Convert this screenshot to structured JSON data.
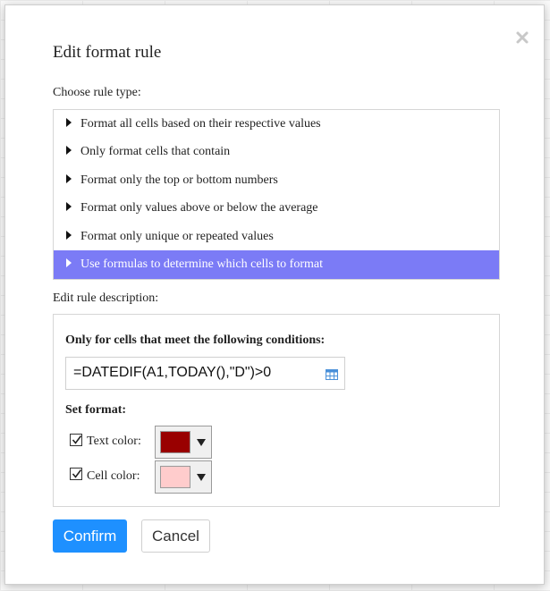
{
  "dialog": {
    "title": "Edit format rule",
    "close_icon": "close-icon"
  },
  "rule_type": {
    "label": "Choose rule type:",
    "items": [
      {
        "label": "Format all cells based on their respective values",
        "selected": false
      },
      {
        "label": "Only format cells that contain",
        "selected": false
      },
      {
        "label": "Format only the top or bottom numbers",
        "selected": false
      },
      {
        "label": "Format only values above or below the average",
        "selected": false
      },
      {
        "label": "Format only unique or repeated values",
        "selected": false
      },
      {
        "label": "Use formulas to determine which cells to format",
        "selected": true
      }
    ],
    "selected_color": "#7b7bf6"
  },
  "description": {
    "label": "Edit rule description:",
    "condition_label": "Only for cells that meet the following conditions:",
    "formula_value": "=DATEDIF(A1,TODAY(),\"D\")>0",
    "range_icon": "table-grid-icon",
    "set_format_label": "Set format:",
    "text_color": {
      "label": "Text color:",
      "checked": true,
      "color": "#990000"
    },
    "cell_color": {
      "label": "Cell color:",
      "checked": true,
      "color": "#ffcccc"
    }
  },
  "buttons": {
    "confirm": "Confirm",
    "cancel": "Cancel",
    "confirm_color": "#1e90ff"
  }
}
